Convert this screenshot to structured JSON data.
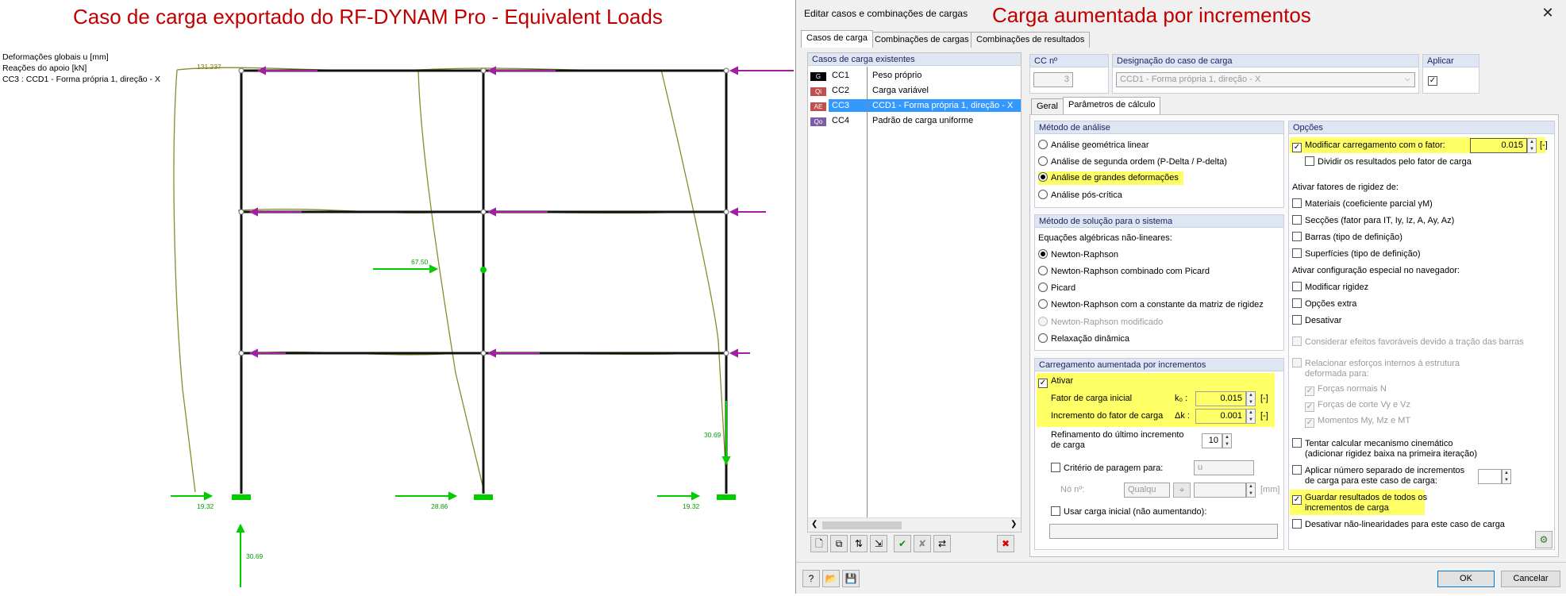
{
  "left": {
    "title": "Caso de carga exportado do RF-DYNAM Pro - Equivalent Loads",
    "info_lines": [
      "Deformações globais u [mm]",
      "Reações do apoio [kN]",
      "CC3 : CCD1 - Forma própria 1, direção - X"
    ],
    "labels": {
      "top_value": "131.237",
      "load_mid": "67.50",
      "reaction_right_vertical": "30.69",
      "reaction_left_h": "19.32",
      "reaction_mid_h": "28.86",
      "reaction_right_h": "19.32",
      "reaction_left_vertical": "30.69"
    }
  },
  "right_title": "Carga aumentada por incrementos",
  "dialog": {
    "title": "Editar casos e combinações de cargas",
    "close": "✕",
    "tabs": [
      "Casos de carga",
      "Combinações de cargas",
      "Combinações de resultados"
    ],
    "lc_list_header": "Casos de carga existentes",
    "load_cases": [
      {
        "badge": "G",
        "badge_color": "#000000",
        "code": "CC1",
        "name": "Peso próprio"
      },
      {
        "badge": "Qi",
        "badge_color": "#c0504d",
        "code": "CC2",
        "name": "Carga variável"
      },
      {
        "badge": "AE",
        "badge_color": "#c0504d",
        "code": "CC3",
        "name": "CCD1 - Forma própria 1, direção - X"
      },
      {
        "badge": "Qo",
        "badge_color": "#7b5ea7",
        "code": "CC4",
        "name": "Padrão de carga uniforme"
      }
    ],
    "cc_no_label": "CC nº",
    "cc_no_value": "3",
    "designation_label": "Designação do caso de carga",
    "designation_value": "CCD1 - Forma própria 1, direção - X",
    "apply_label": "Aplicar",
    "sub_tabs": [
      "Geral",
      "Parâmetros de cálculo"
    ],
    "analysis": {
      "header": "Método de análise",
      "options": [
        "Análise geométrica linear",
        "Análise de segunda ordem (P-Delta / P-delta)",
        "Análise de grandes deformações",
        "Análise pós-crítica"
      ]
    },
    "solution": {
      "header": "Método de solução para o sistema",
      "sublabel": "Equações algébricas não-lineares:",
      "options": [
        "Newton-Raphson",
        "Newton-Raphson combinado com Picard",
        "Picard",
        "Newton-Raphson com a constante da matriz de rigidez",
        "Newton-Raphson modificado",
        "Relaxação dinâmica"
      ]
    },
    "incremental": {
      "header": "Carregamento aumentada por incrementos",
      "activate": "Ativar",
      "initial_factor_label": "Fator de carga inicial",
      "initial_factor_symbol": "k₀ :",
      "initial_factor_value": "0.015",
      "increment_label": "Incremento do fator de carga",
      "increment_symbol": "Δk :",
      "increment_value": "0.001",
      "unit": "[-]",
      "refinement_label_1": "Refinamento do último incremento",
      "refinement_label_2": "de carga",
      "refinement_value": "10",
      "stop_criterion": "Critério de paragem para:",
      "stop_select": "u",
      "node_label": "Nó nº:",
      "node_select": "Qualqu",
      "mm_unit": "[mm]",
      "initial_load": "Usar carga inicial (não aumentando):"
    },
    "options": {
      "header": "Opções",
      "modify_factor_label": "Modificar carregamento com o fator:",
      "modify_factor_value": "0.015",
      "unit": "[-]",
      "divide_results": "Dividir os resultados pelo fator de carga",
      "stiffness_label": "Ativar fatores de rigidez de:",
      "stiffness_items": [
        "Materiais (coeficiente parcial γM)",
        "Secções (fator para IT, Iy, Iz, A, Ay, Az)",
        "Barras (tipo de definição)",
        "Superfícies (tipo de definição)"
      ],
      "navigator_label": "Ativar configuração especial no navegador:",
      "navigator_items": [
        "Modificar rigidez",
        "Opções extra",
        "Desativar"
      ],
      "favorable": "Considerar efeitos favoráveis devido a tração das barras",
      "relate_1": "Relacionar esforços internos à estrutura",
      "relate_2": "deformada para:",
      "relate_items": [
        "Forças normais N",
        "Forças de corte Vy e Vz",
        "Momentos My, Mz e MT"
      ],
      "kinematic_1": "Tentar calcular mecanismo cinemático",
      "kinematic_2": "(adicionar rigidez baixa na primeira iteração)",
      "separate_1": "Aplicar número separado de incrementos",
      "separate_2": "de carga para este caso de carga:",
      "save_1": "Guardar resultados de todos os",
      "save_2": "incrementos de carga",
      "disable_nonlinear": "Desativar não-linearidades para este caso de carga"
    },
    "ok": "OK",
    "cancel": "Cancelar"
  }
}
